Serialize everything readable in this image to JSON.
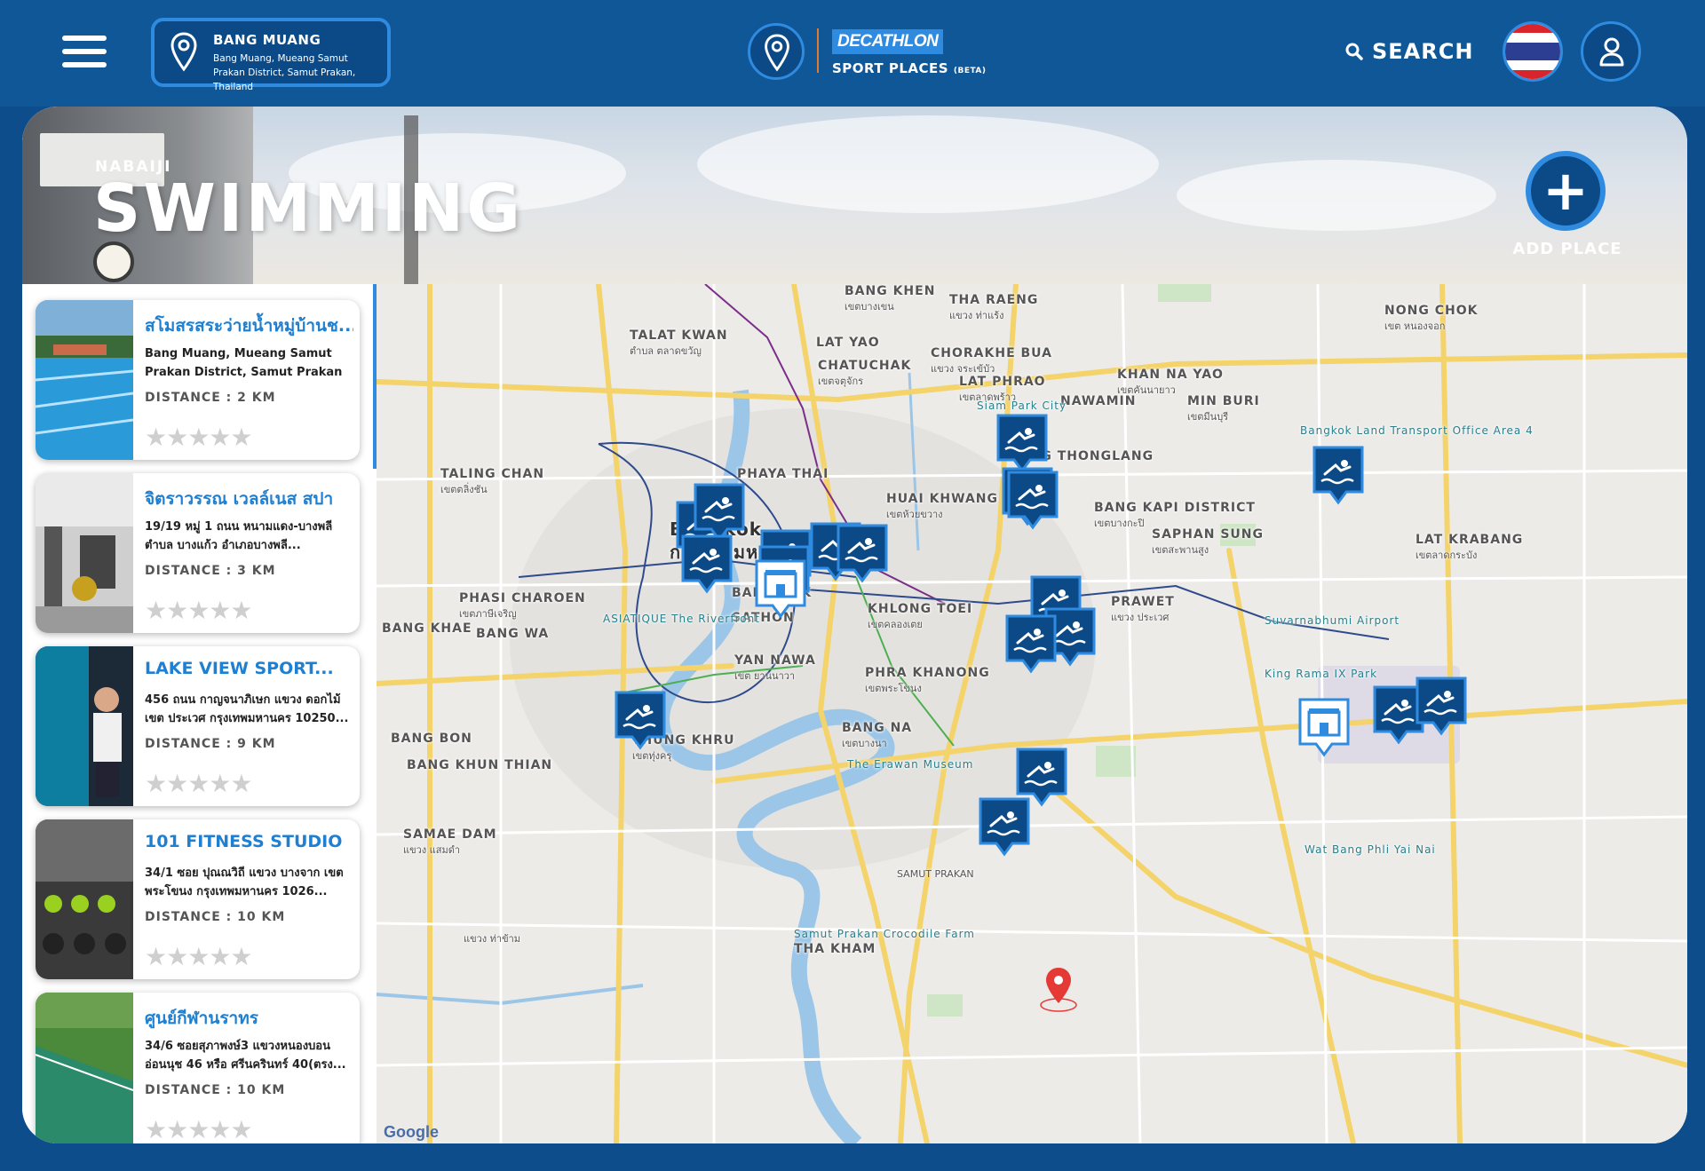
{
  "header": {
    "location_title": "BANG MUANG",
    "location_address": "Bang Muang, Mueang Samut Prakan District, Samut Prakan, Thailand",
    "brand": "DECATHLON",
    "product": "SPORT PLACES",
    "product_tag": "(BETA)",
    "search_label": "SEARCH"
  },
  "hero": {
    "brand_sub": "NABAIJI",
    "sport_title": "SWIMMING",
    "add_label": "ADD PLACE"
  },
  "places": [
    {
      "name": "สโมสรสระว่ายน้ำหมู่บ้านช...",
      "address": "Bang Muang, Mueang Samut Prakan District, Samut Prakan 10270,...",
      "distance": "DISTANCE : 2 KM",
      "rating": "★★★★★"
    },
    {
      "name": "จิตราวรรณ เวลล์เนส สปา",
      "address": "19/19 หมู่ 1 ถนน หนามแดง-บางพลี ตำบล บางแก้ว อำเภอบางพลี...",
      "distance": "DISTANCE : 3 KM",
      "rating": "★★★★★"
    },
    {
      "name": "LAKE VIEW SPORT...",
      "address": "456 ถนน กาญจนาภิเษก แขวง ดอกไม้ เขต ประเวศ กรุงเทพมหานคร 10250...",
      "distance": "DISTANCE : 9 KM",
      "rating": "★★★★★"
    },
    {
      "name": "101 FITNESS STUDIO",
      "address": "34/1 ซอย ปุณณวิถี แขวง บางจาก เขตพระโขนง กรุงเทพมหานคร 1026...",
      "distance": "DISTANCE : 10 KM",
      "rating": "★★★★★"
    },
    {
      "name": "ศูนย์กีฬานราทร",
      "address": "34/6 ซอยสุภาพงษ์3 แขวงหนองบอน อ่อนนุช 46 หรือ ศรีนครินทร์ 40(ตรง...",
      "distance": "DISTANCE : 10 KM",
      "rating": "★★★★★"
    }
  ],
  "map": {
    "labels": [
      {
        "text": "BANG KHEN",
        "cls": ""
      },
      {
        "text": "เขตบางเขน",
        "cls": "sub"
      },
      {
        "text": "THA RAENG",
        "cls": ""
      },
      {
        "text": "แขวง ท่าแร้ง",
        "cls": "sub"
      },
      {
        "text": "NONG CHOK",
        "cls": ""
      },
      {
        "text": "เขต หนองจอก",
        "cls": "sub"
      },
      {
        "text": "TALAT KWAN",
        "cls": ""
      },
      {
        "text": "ตำบล ตลาดขวัญ",
        "cls": "sub"
      },
      {
        "text": "LAT YAO",
        "cls": ""
      },
      {
        "text": "CHATUCHAK",
        "cls": ""
      },
      {
        "text": "เขตจตุจักร",
        "cls": "sub"
      },
      {
        "text": "CHORAKHE BUA",
        "cls": ""
      },
      {
        "text": "แขวง จระเข้บัว",
        "cls": "sub"
      },
      {
        "text": "KHAN NA YAO",
        "cls": ""
      },
      {
        "text": "เขตคันนายาว",
        "cls": "sub"
      },
      {
        "text": "LAT PHRAO",
        "cls": ""
      },
      {
        "text": "เขตลาดพร้าว",
        "cls": "sub"
      },
      {
        "text": "NAWAMIN",
        "cls": ""
      },
      {
        "text": "MIN BURI",
        "cls": ""
      },
      {
        "text": "เขตมีนบุรี",
        "cls": "sub"
      },
      {
        "text": "Siam Park City",
        "cls": "poi"
      },
      {
        "text": "Bangkok Land Transport Office Area 4",
        "cls": "poi"
      },
      {
        "text": "TALING CHAN",
        "cls": ""
      },
      {
        "text": "เขตตลิ่งชัน",
        "cls": "sub"
      },
      {
        "text": "PHAYA THAI",
        "cls": ""
      },
      {
        "text": "WANG THONGLANG",
        "cls": ""
      },
      {
        "text": "HUAI KHWANG",
        "cls": ""
      },
      {
        "text": "เขตห้วยขวาง",
        "cls": "sub"
      },
      {
        "text": "BANG KAPI DISTRICT",
        "cls": ""
      },
      {
        "text": "เขตบางกะปิ",
        "cls": "sub"
      },
      {
        "text": "Bangkok",
        "cls": "big"
      },
      {
        "text": "กรุงเทพมหานคร",
        "cls": "big"
      },
      {
        "text": "SAPHAN SUNG",
        "cls": ""
      },
      {
        "text": "เขตสะพานสูง",
        "cls": "sub"
      },
      {
        "text": "LAT KRABANG",
        "cls": ""
      },
      {
        "text": "เขตลาดกระบัง",
        "cls": "sub"
      },
      {
        "text": "PHASI CHAROEN",
        "cls": ""
      },
      {
        "text": "เขตภาษีเจริญ",
        "cls": "sub"
      },
      {
        "text": "BANG RAK",
        "cls": ""
      },
      {
        "text": "SATHON",
        "cls": ""
      },
      {
        "text": "KHLONG TOEI",
        "cls": ""
      },
      {
        "text": "เขตคลองเตย",
        "cls": "sub"
      },
      {
        "text": "PRAWET",
        "cls": ""
      },
      {
        "text": "แขวง ประเวศ",
        "cls": "sub"
      },
      {
        "text": "BANG KHAE",
        "cls": ""
      },
      {
        "text": "BANG WA",
        "cls": ""
      },
      {
        "text": "ASIATIQUE The Riverfront",
        "cls": "poi"
      },
      {
        "text": "Suvarnabhumi Airport",
        "cls": "poi"
      },
      {
        "text": "YAN NAWA",
        "cls": ""
      },
      {
        "text": "เขต ยานนาวา",
        "cls": "sub"
      },
      {
        "text": "PHRA KHANONG",
        "cls": ""
      },
      {
        "text": "เขตพระโขนง",
        "cls": "sub"
      },
      {
        "text": "King Rama IX Park",
        "cls": "poi"
      },
      {
        "text": "BANG BON",
        "cls": ""
      },
      {
        "text": "BANG KHUN THIAN",
        "cls": ""
      },
      {
        "text": "THUNG KHRU",
        "cls": ""
      },
      {
        "text": "เขตทุ่งครุ",
        "cls": "sub"
      },
      {
        "text": "BANG NA",
        "cls": ""
      },
      {
        "text": "เขตบางนา",
        "cls": "sub"
      },
      {
        "text": "The Erawan Museum",
        "cls": "poi"
      },
      {
        "text": "SAMAE DAM",
        "cls": ""
      },
      {
        "text": "แขวง แสมดำ",
        "cls": "sub"
      },
      {
        "text": "Wat Bang Phli Yai Nai",
        "cls": "poi"
      },
      {
        "text": "SAMUT PRAKAN",
        "cls": "sub"
      },
      {
        "text": "Samut Prakan Crocodile Farm",
        "cls": "poi"
      },
      {
        "text": "THA KHAM",
        "cls": ""
      },
      {
        "text": "แขวง ท่าข้าม",
        "cls": "sub"
      }
    ],
    "attribution": "Google"
  },
  "colors": {
    "header_bg": "#0f5796",
    "accent": "#2f8be0",
    "marker": "#0c4a87",
    "title_link": "#1f7fd1",
    "location_pin": "#e53935"
  },
  "icons": [
    "menu-icon",
    "location-pin-icon",
    "search-icon",
    "thailand-flag-icon",
    "user-icon",
    "plus-icon",
    "swimming-marker-icon",
    "store-marker-icon",
    "star-icon"
  ]
}
